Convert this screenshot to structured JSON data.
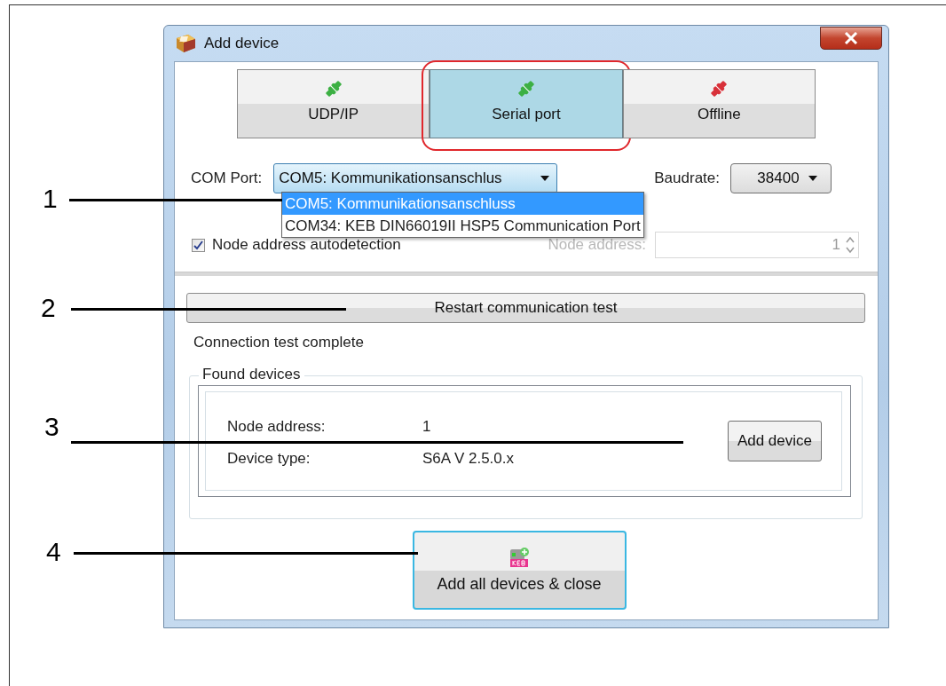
{
  "window": {
    "title": "Add device"
  },
  "tabs": [
    {
      "label": "UDP/IP",
      "selected": false,
      "color": "#3cb043"
    },
    {
      "label": "Serial port",
      "selected": true,
      "color": "#3cb043"
    },
    {
      "label": "Offline",
      "selected": false,
      "color": "#d8313a"
    }
  ],
  "com_port": {
    "label": "COM Port:",
    "value": "COM5: Kommunikationsanschlus",
    "expanded": true,
    "options": [
      {
        "label": "COM5: Kommunikationsanschluss",
        "selected": true
      },
      {
        "label": "COM34: KEB DIN66019II HSP5 Communication Port",
        "selected": false
      }
    ]
  },
  "baudrate": {
    "label": "Baudrate:",
    "value": "38400"
  },
  "autodetect": {
    "label": "Node address autodetection",
    "checked": true
  },
  "node_address": {
    "label": "Node address:",
    "value": "1",
    "disabled": true
  },
  "restart_button": "Restart communication test",
  "status_text": "Connection test complete",
  "found_devices": {
    "title": "Found devices",
    "devices": [
      {
        "fields": [
          {
            "label": "Node address:",
            "value": "1"
          },
          {
            "label": "Device type:",
            "value": "S6A V 2.5.0.x"
          }
        ],
        "button": "Add device"
      }
    ]
  },
  "add_all_button": "Add all devices & close",
  "callouts": [
    "1",
    "2",
    "3",
    "4"
  ]
}
